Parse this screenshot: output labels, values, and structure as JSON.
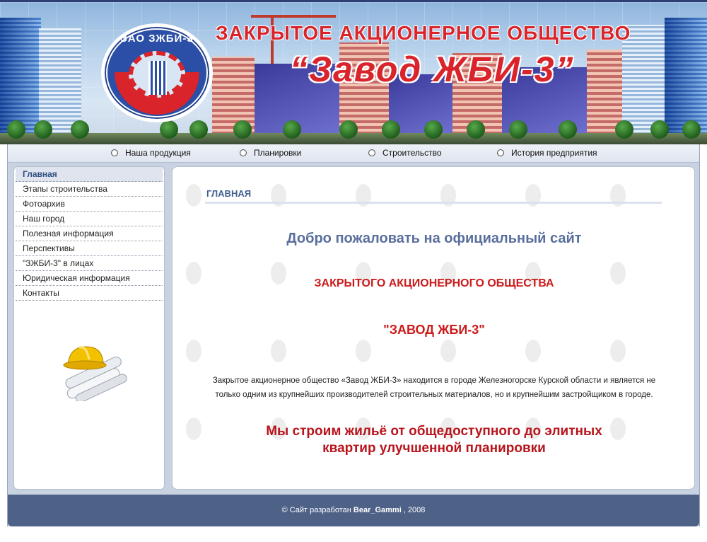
{
  "header": {
    "company_line1": "ЗАКРЫТОЕ АКЦИОНЕРНОЕ ОБЩЕСТВО",
    "company_line2": "“Завод ЖБИ-3”",
    "logo_text": "ЗАО ЗЖБИ-3",
    "accent_color": "#d8242a",
    "brand_blue": "#2b4ea6"
  },
  "topnav": {
    "items": [
      {
        "label": "Наша продукция",
        "icon": "radio-bullet-icon"
      },
      {
        "label": "Планировки",
        "icon": "radio-bullet-icon"
      },
      {
        "label": "Строительство",
        "icon": "radio-bullet-icon"
      },
      {
        "label": "История предприятия",
        "icon": "radio-bullet-icon"
      }
    ]
  },
  "sidebar": {
    "items": [
      {
        "label": "Главная",
        "active": true
      },
      {
        "label": "Этапы строительства"
      },
      {
        "label": "Фотоархив"
      },
      {
        "label": "Наш город"
      },
      {
        "label": "Полезная информация"
      },
      {
        "label": "Перспективы"
      },
      {
        "label": "\"ЗЖБИ-3\" в лицах"
      },
      {
        "label": "Юридическая информация"
      },
      {
        "label": "Контакты"
      }
    ],
    "image_icon": "hard-hat-blueprints-icon"
  },
  "content": {
    "section_title": "ГЛАВНАЯ",
    "welcome": "Добро пожаловать на официальный сайт",
    "company_type": "ЗАКРЫТОГО АКЦИОНЕРНОГО ОБЩЕСТВА",
    "company_name": "\"ЗАВОД ЖБИ-3\"",
    "about": "Закрытое акционерное общество «Завод ЖБИ-3» находится в городе Железногорске Курской области и является не только одним из крупнейших производителей строительных материалов, но и крупнейшим застройщиком в городе.",
    "slogan": "Мы   строим   жильё от общедоступного до элитных\nквартир улучшенной планировки",
    "slogan_color": "#b8141c"
  },
  "footer": {
    "prefix": "© Сайт разработан",
    "author": "Bear_Gammi",
    "suffix": ", 2008",
    "background": "#4e6288"
  }
}
